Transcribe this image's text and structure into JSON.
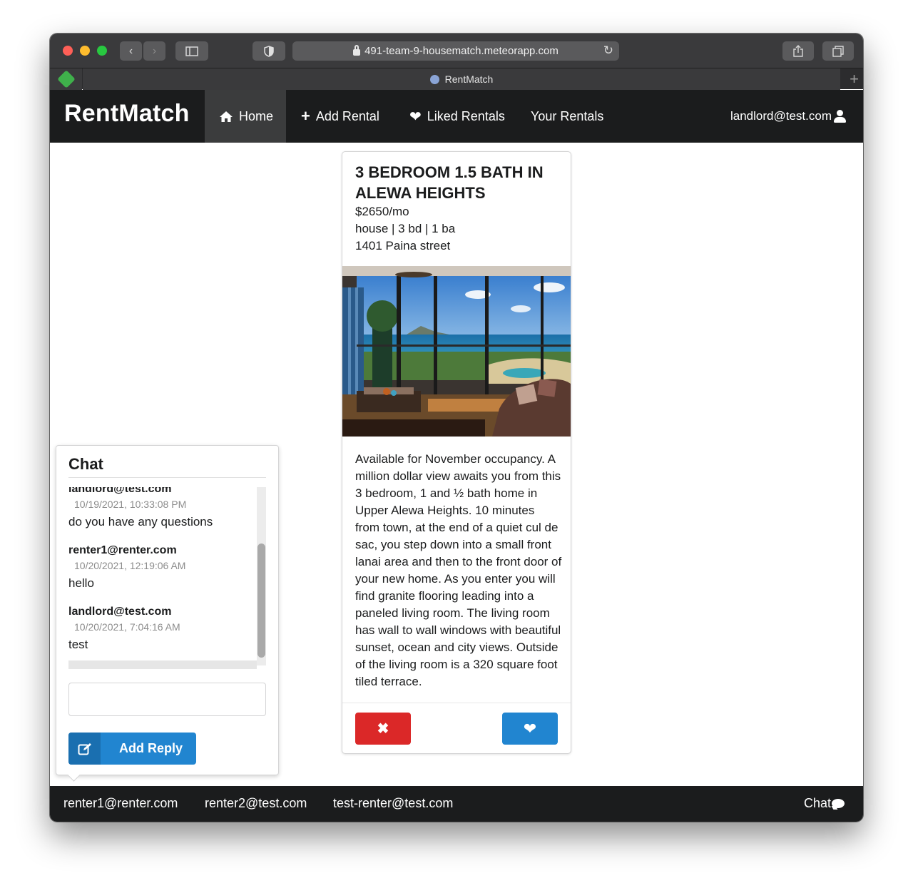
{
  "browser": {
    "url": "491-team-9-housematch.meteorapp.com",
    "tab_title": "RentMatch"
  },
  "navbar": {
    "brand": "RentMatch",
    "items": [
      {
        "label": "Home",
        "icon": "home-icon",
        "active": true
      },
      {
        "label": "Add Rental",
        "icon": "plus-icon",
        "active": false
      },
      {
        "label": "Liked Rentals",
        "icon": "heart-icon",
        "active": false
      },
      {
        "label": "Your Rentals",
        "icon": "",
        "active": false
      }
    ],
    "user_email": "landlord@test.com"
  },
  "listing": {
    "title": "3 Bedroom 1.5 Bath in Alewa Heights",
    "price": "$2650/mo",
    "details": "house | 3 bd | 1 ba",
    "address": "1401 Paina street",
    "description": "Available for November occupancy. A million dollar view awaits you from this 3 bedroom, 1 and ½ bath home in Upper Alewa Heights. 10 minutes from town, at the end of a quiet cul de sac, you step down into a small front lanai area and then to the front door of your new home. As you enter you will find granite flooring leading into a paneled living room. The living room has wall to wall windows with beautiful sunset, ocean and city views. Outside of the living room is a 320 square foot tiled terrace.",
    "reject_icon": "x-icon",
    "like_icon": "heart-icon"
  },
  "chat": {
    "title": "Chat",
    "messages": [
      {
        "author": "landlord@test.com",
        "date": "10/19/2021, 10:33:08 PM",
        "text": "do you have any questions"
      },
      {
        "author": "renter1@renter.com",
        "date": "10/20/2021, 12:19:06 AM",
        "text": "hello"
      },
      {
        "author": "landlord@test.com",
        "date": "10/20/2021, 7:04:16 AM",
        "text": "test"
      }
    ],
    "input_value": "",
    "reply_label": "Add Reply",
    "reply_icon": "edit-icon"
  },
  "bottombar": {
    "contacts": [
      "renter1@renter.com",
      "renter2@test.com",
      "test-renter@test.com"
    ],
    "chat_label": "Chat"
  },
  "colors": {
    "navbar": "#1b1c1d",
    "reject": "#db2828",
    "like": "#2185d0"
  }
}
